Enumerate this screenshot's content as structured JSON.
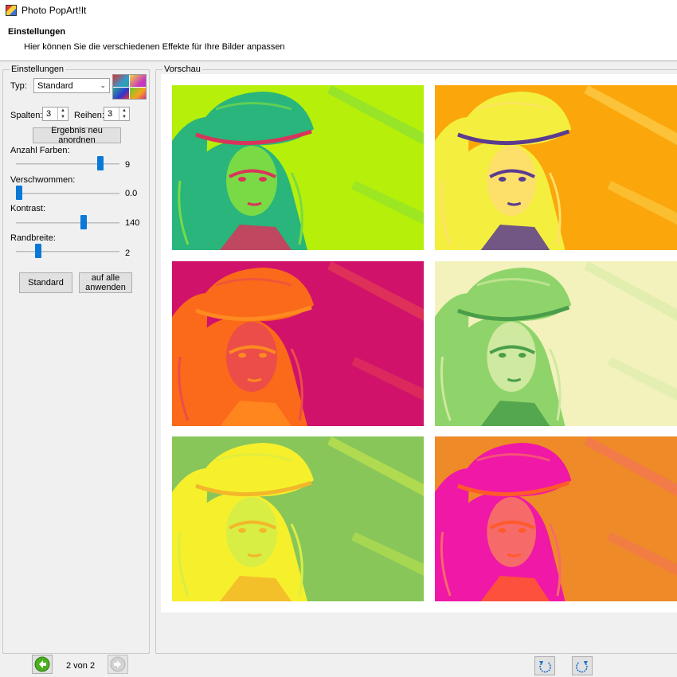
{
  "window": {
    "title": "Photo PopArt!It"
  },
  "header": {
    "title": "Einstellungen",
    "subtitle": "Hier können Sie die verschiedenen Effekte für Ihre Bilder anpassen"
  },
  "settings": {
    "group_label": "Einstellungen",
    "type_label": "Typ:",
    "type_value": "Standard",
    "columns_label": "Spalten:",
    "columns_value": "3",
    "rows_label": "Reihen:",
    "rows_value": "3",
    "rearrange_button": "Ergebnis neu anordnen",
    "sliders": [
      {
        "label": "Anzahl Farben:",
        "value": "9",
        "fraction": 0.84
      },
      {
        "label": "Verschwommen:",
        "value": "0.0",
        "fraction": 0.0
      },
      {
        "label": "Kontrast:",
        "value": "140",
        "fraction": 0.66
      },
      {
        "label": "Randbreite:",
        "value": "2",
        "fraction": 0.2
      }
    ],
    "default_button": "Standard",
    "apply_all_button_line1": "auf alle",
    "apply_all_button_line2": "anwenden"
  },
  "preview": {
    "group_label": "Vorschau",
    "tiles": [
      {
        "bg": "#b5ef0a",
        "fg": "#29b57c",
        "accent": "#d9345a",
        "light": "#79da45"
      },
      {
        "bg": "#fba70b",
        "fg": "#f4ef3f",
        "accent": "#5a3b8f",
        "light": "#fde06a"
      },
      {
        "bg": "#d0126b",
        "fg": "#fa6a1a",
        "accent": "#ff8a20",
        "light": "#ec4d48"
      },
      {
        "bg": "#f3f2bd",
        "fg": "#8fd46a",
        "accent": "#4a9e4a",
        "light": "#cfe9a0"
      },
      {
        "bg": "#88c65a",
        "fg": "#f6ef2c",
        "accent": "#f3b72a",
        "light": "#d8ee45"
      },
      {
        "bg": "#ee8a28",
        "fg": "#f018a6",
        "accent": "#ff5b2a",
        "light": "#f76a6a"
      }
    ]
  },
  "footer": {
    "page_label": "2 von 2",
    "back_icon": "green-left-arrow",
    "forward_icon": "grey-right-arrow",
    "rotate_left_icon": "rotate-ccw",
    "rotate_right_icon": "rotate-cw"
  }
}
